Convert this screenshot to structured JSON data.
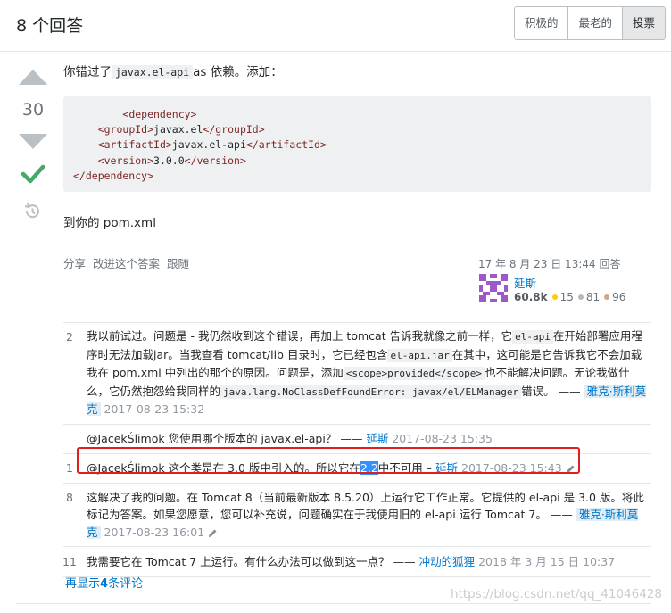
{
  "header": {
    "answers_title": "8 个回答",
    "tabs": [
      {
        "label": "积极的",
        "active": false
      },
      {
        "label": "最老的",
        "active": false
      },
      {
        "label": "投票",
        "active": true
      }
    ]
  },
  "answer": {
    "vote_count": "30",
    "accepted": true,
    "p1_before": "你错过了",
    "p1_code": "javax.el-api",
    "p1_after": "as 依赖。添加：",
    "code_lines": [
      {
        "indent": "",
        "tag_open": "<dependency>",
        "text": "",
        "tag_close": ""
      },
      {
        "indent": "    ",
        "tag_open": "<groupId>",
        "text": "javax.el",
        "tag_close": "</groupId>"
      },
      {
        "indent": "    ",
        "tag_open": "<artifactId>",
        "text": "javax.el-api",
        "tag_close": "</artifactId>"
      },
      {
        "indent": "    ",
        "tag_open": "<version>",
        "text": "3.0.0",
        "tag_close": "</version>"
      },
      {
        "indent": "",
        "tag_open": "</dependency>",
        "text": "",
        "tag_close": ""
      }
    ],
    "p2": "到你的 pom.xml",
    "actions": [
      "分享",
      "改进这个答案",
      "跟随"
    ],
    "answered": "17 年 8 月 23 日 13:44 回答",
    "user": {
      "name": "延斯",
      "reputation": "60.8k",
      "gold": "15",
      "silver": "81",
      "bronze": "96",
      "gold_color": "#ffcc01",
      "silver_color": "#b4b8bc",
      "bronze_color": "#d1a684"
    }
  },
  "comments": {
    "c1": {
      "score": "2",
      "t1": "我以前试过。问题是 - 我仍然收到这个错误，再加上 tomcat 告诉我就像之前一样，它",
      "code1": "el-api",
      "t2": "在开始部署应用程序时无法加载jar。当我查看 tomcat/lib 目录时，它已经包含",
      "code2": "el-api.jar",
      "t3": "在其中，这可能是它告诉我它不会加载我在 pom.xml 中列出的那个的原因。问题是，添加",
      "code3": "<scope>provided</scope>",
      "t4": "也不能解决问题。无论我做什么，它仍然抱怨给我同样的",
      "code4": "java.lang.NoClassDefFoundError: javax/el/ELManager",
      "t5": "错误。 ——",
      "user": "雅克·斯利莫克",
      "date": "2017-08-23 15:32"
    },
    "c2": {
      "score": "",
      "text": "@JacekŚlimok 您使用哪个版本的 javax.el-api？ ——",
      "user": "延斯",
      "date": "2017-08-23 15:35"
    },
    "c3": {
      "score": "1",
      "t1": "@JacekŚlimok 这个类是在 3.0 版中引入的。所以它在",
      "selected": "2.2",
      "t2": "中不可用 –",
      "user": "延斯",
      "date": "2017-08-23 15:43"
    },
    "c4": {
      "score": "8",
      "text": "这解决了我的问题。在 Tomcat 8（当前最新版本 8.5.20）上运行它工作正常。它提供的 el-api 是 3.0 版。将此标记为答案。如果您愿意，您可以补充说，问题确实在于我使用旧的 el-api 运行 Tomcat 7。 ——",
      "user": "雅克·斯利莫克",
      "date": "2017-08-23 16:01"
    },
    "c5": {
      "score": "11",
      "text": "我需要它在 Tomcat 7 上运行。有什么办法可以做到这一点？ ——",
      "user": "冲动的狐狸",
      "date": "2018 年 3 月 15 日 10:37"
    },
    "more_prefix": "再显示",
    "more_count": "4",
    "more_suffix": "条评论"
  },
  "watermark": "https://blog.csdn.net/qq_41046428"
}
